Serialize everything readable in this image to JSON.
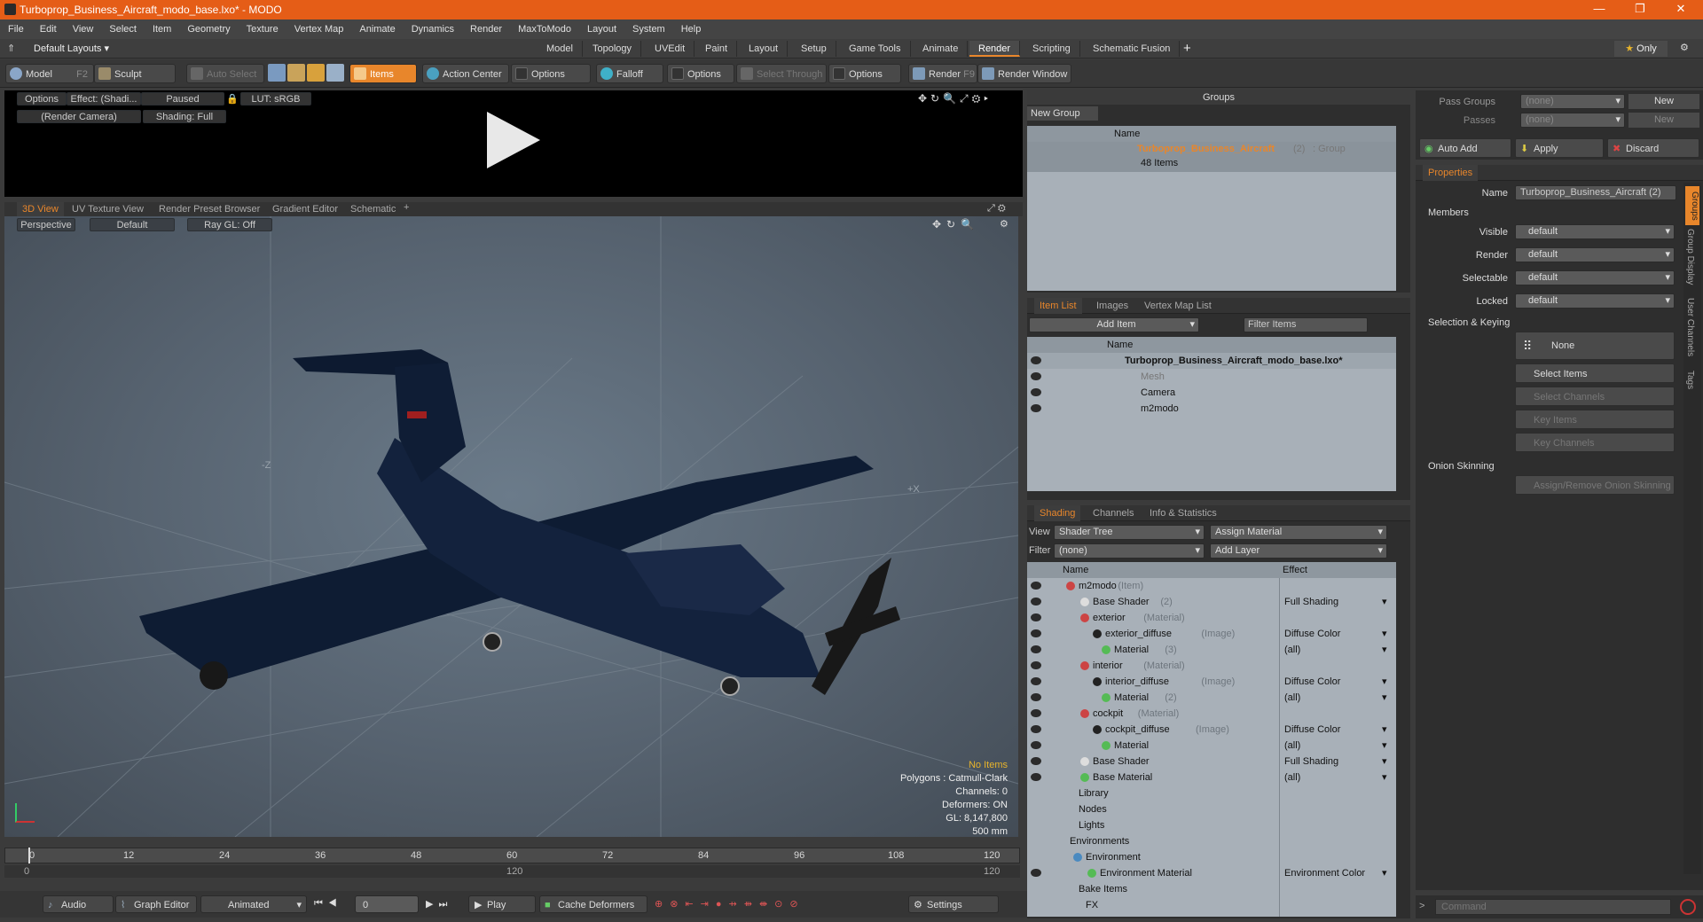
{
  "window": {
    "title": "Turboprop_Business_Aircraft_modo_base.lxo* - MODO"
  },
  "menu": [
    "File",
    "Edit",
    "View",
    "Select",
    "Item",
    "Geometry",
    "Texture",
    "Vertex Map",
    "Animate",
    "Dynamics",
    "Render",
    "MaxToModo",
    "Layout",
    "System",
    "Help"
  ],
  "layout": {
    "preset": "Default Layouts",
    "tabs": [
      "Model",
      "Topology",
      "UVEdit",
      "Paint",
      "Layout",
      "Setup",
      "Game Tools",
      "Animate",
      "Render",
      "Scripting",
      "Schematic Fusion"
    ],
    "active": "Render",
    "only": "Only"
  },
  "toolbar": {
    "model": "Model",
    "model_key": "F2",
    "sculpt": "Sculpt",
    "auto_select": "Auto Select",
    "items": "Items",
    "action_center": "Action Center",
    "options1": "Options",
    "falloff": "Falloff",
    "options2": "Options",
    "select_through": "Select Through",
    "options3": "Options",
    "render": "Render",
    "render_key": "F9",
    "render_window": "Render Window"
  },
  "preview": {
    "options": "Options",
    "effect": "Effect: (Shadi...",
    "paused": "Paused",
    "lut": "LUT: sRGB",
    "camera": "(Render Camera)",
    "shading": "Shading: Full"
  },
  "viewport_tabs": [
    "3D View",
    "UV Texture View",
    "Render Preset Browser",
    "Gradient Editor",
    "Schematic"
  ],
  "viewport": {
    "perspective": "Perspective",
    "default": "Default",
    "raygl": "Ray GL: Off",
    "axis_x": "+X",
    "axis_z": "-Z",
    "stats": {
      "no_items": "No Items",
      "polygons": "Polygons : Catmull-Clark",
      "channels": "Channels: 0",
      "deformers": "Deformers: ON",
      "gl": "GL: 8,147,800",
      "size": "500 mm"
    }
  },
  "timeline": {
    "ticks": [
      "0",
      "12",
      "24",
      "36",
      "48",
      "60",
      "72",
      "84",
      "96",
      "108",
      "120"
    ],
    "sub_ticks": [
      "0",
      "120",
      "120"
    ]
  },
  "bottom": {
    "audio": "Audio",
    "graph_editor": "Graph Editor",
    "animated": "Animated",
    "frame": "0",
    "play": "Play",
    "cache_deformers": "Cache Deformers",
    "settings": "Settings"
  },
  "groups": {
    "title": "Groups",
    "new_group": "New Group",
    "col_name": "Name",
    "item_name": "Turboprop_Business_Aircraft",
    "item_count": "(2)",
    "item_type": ": Group",
    "item_sub": "48 Items"
  },
  "itemlist": {
    "tabs": [
      "Item List",
      "Images",
      "Vertex Map List"
    ],
    "add_item": "Add Item",
    "filter": "Filter Items",
    "col_name": "Name",
    "items": [
      {
        "name": "Turboprop_Business_Aircraft_modo_base.lxo*"
      },
      {
        "name": "Mesh"
      },
      {
        "name": "Camera"
      },
      {
        "name": "m2modo"
      }
    ]
  },
  "shading": {
    "tabs": [
      "Shading",
      "Channels",
      "Info & Statistics"
    ],
    "view_label": "View",
    "view_value": "Shader Tree",
    "assign": "Assign Material",
    "filter_label": "Filter",
    "filter_value": "(none)",
    "add_layer": "Add Layer",
    "col_name": "Name",
    "col_effect": "Effect",
    "rows": [
      {
        "name": "m2modo",
        "tag": "(Item)",
        "effect": ""
      },
      {
        "name": "Base Shader",
        "tag": "(2)",
        "effect": "Full Shading"
      },
      {
        "name": "exterior",
        "tag": "(Material)",
        "effect": ""
      },
      {
        "name": "exterior_diffuse",
        "tag": "(Image)",
        "effect": "Diffuse Color"
      },
      {
        "name": "Material",
        "tag": "(3)",
        "effect": "(all)"
      },
      {
        "name": "interior",
        "tag": "(Material)",
        "effect": ""
      },
      {
        "name": "interior_diffuse",
        "tag": "(Image)",
        "effect": "Diffuse Color"
      },
      {
        "name": "Material",
        "tag": "(2)",
        "effect": "(all)"
      },
      {
        "name": "cockpit",
        "tag": "(Material)",
        "effect": ""
      },
      {
        "name": "cockpit_diffuse",
        "tag": "(Image)",
        "effect": "Diffuse Color"
      },
      {
        "name": "Material",
        "tag": "",
        "effect": "(all)"
      },
      {
        "name": "Base Shader",
        "tag": "",
        "effect": "Full Shading"
      },
      {
        "name": "Base Material",
        "tag": "",
        "effect": "(all)"
      },
      {
        "name": "Library",
        "tag": "",
        "effect": ""
      },
      {
        "name": "Nodes",
        "tag": "",
        "effect": ""
      },
      {
        "name": "Lights",
        "tag": "",
        "effect": ""
      },
      {
        "name": "Environments",
        "tag": "",
        "effect": ""
      },
      {
        "name": "Environment",
        "tag": "",
        "effect": ""
      },
      {
        "name": "Environment Material",
        "tag": "",
        "effect": "Environment Color"
      },
      {
        "name": "Bake Items",
        "tag": "",
        "effect": ""
      },
      {
        "name": "FX",
        "tag": "",
        "effect": ""
      }
    ]
  },
  "passes": {
    "pass_groups": "Pass Groups",
    "passes": "Passes",
    "none1": "(none)",
    "none2": "(none)",
    "new1": "New",
    "new2": "New",
    "auto_add": "Auto Add",
    "apply": "Apply",
    "discard": "Discard"
  },
  "properties": {
    "tab": "Properties",
    "name_label": "Name",
    "name_value": "Turboprop_Business_Aircraft (2)",
    "members": "Members",
    "visible": "Visible",
    "render": "Render",
    "selectable": "Selectable",
    "locked": "Locked",
    "default": "default",
    "sel_keying": "Selection & Keying",
    "none": "None",
    "select_items": "Select Items",
    "select_channels": "Select Channels",
    "key_items": "Key Items",
    "key_channels": "Key Channels",
    "onion": "Onion Skinning",
    "assign_onion": "Assign/Remove Onion Skinning",
    "side_tabs": [
      "Groups",
      "Group Display",
      "User Channels",
      "Tags"
    ]
  },
  "command": {
    "placeholder": "Command"
  },
  "colors": {
    "accent": "#e8862b",
    "titlebar": "#e55d17"
  }
}
